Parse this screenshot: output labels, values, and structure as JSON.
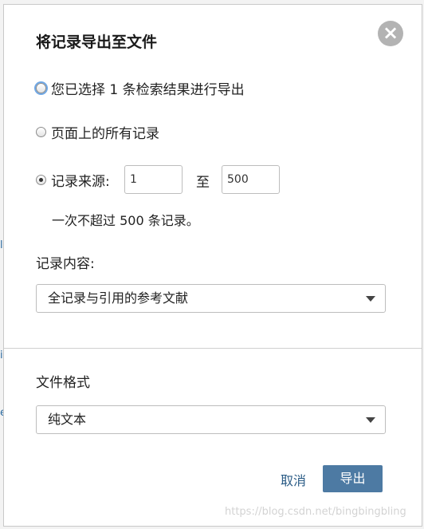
{
  "dialog": {
    "title": "将记录导出至文件",
    "close_icon": "close-icon"
  },
  "options": {
    "selected_records": "您已选择 1 条检索结果进行导出",
    "all_on_page": "页面上的所有记录",
    "record_source": "记录来源:",
    "from_value": "1",
    "to_label": "至",
    "to_value": "500",
    "limit_note": "一次不超过 500 条记录。"
  },
  "record_content": {
    "label": "记录内容:",
    "selected": "全记录与引用的参考文献"
  },
  "file_format": {
    "label": "文件格式",
    "selected": "纯文本"
  },
  "actions": {
    "cancel": "取消",
    "export": "导出"
  },
  "watermark": "https://blog.csdn.net/bingbingbling"
}
